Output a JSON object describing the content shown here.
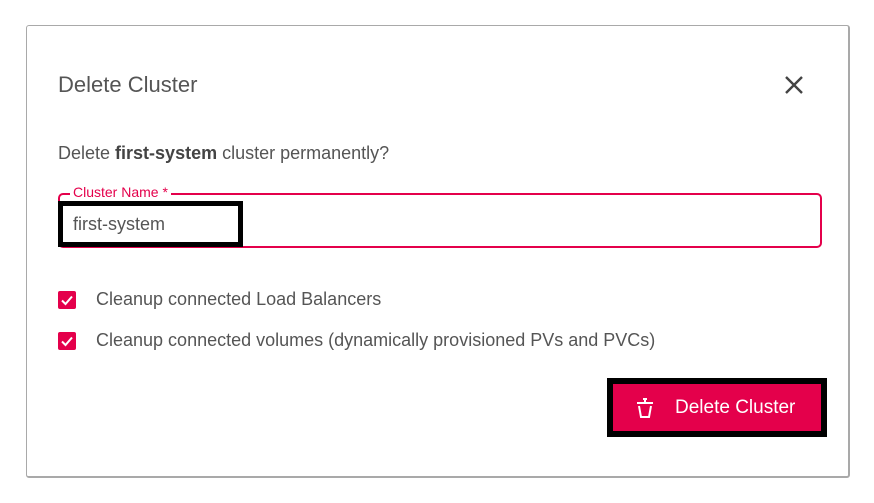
{
  "dialog": {
    "title": "Delete Cluster",
    "close_icon": "close-icon",
    "question_prefix": "Delete ",
    "cluster_name": "first-system",
    "question_suffix": " cluster permanently?",
    "field": {
      "label": "Cluster Name *",
      "value": "first-system"
    },
    "checkboxes": [
      {
        "label": "Cleanup connected Load Balancers",
        "checked": true
      },
      {
        "label": "Cleanup connected volumes (dynamically provisioned PVs and PVCs)",
        "checked": true
      }
    ],
    "delete_button": {
      "label": "Delete Cluster",
      "icon": "trash-icon"
    },
    "accent_color": "#e4004b"
  }
}
